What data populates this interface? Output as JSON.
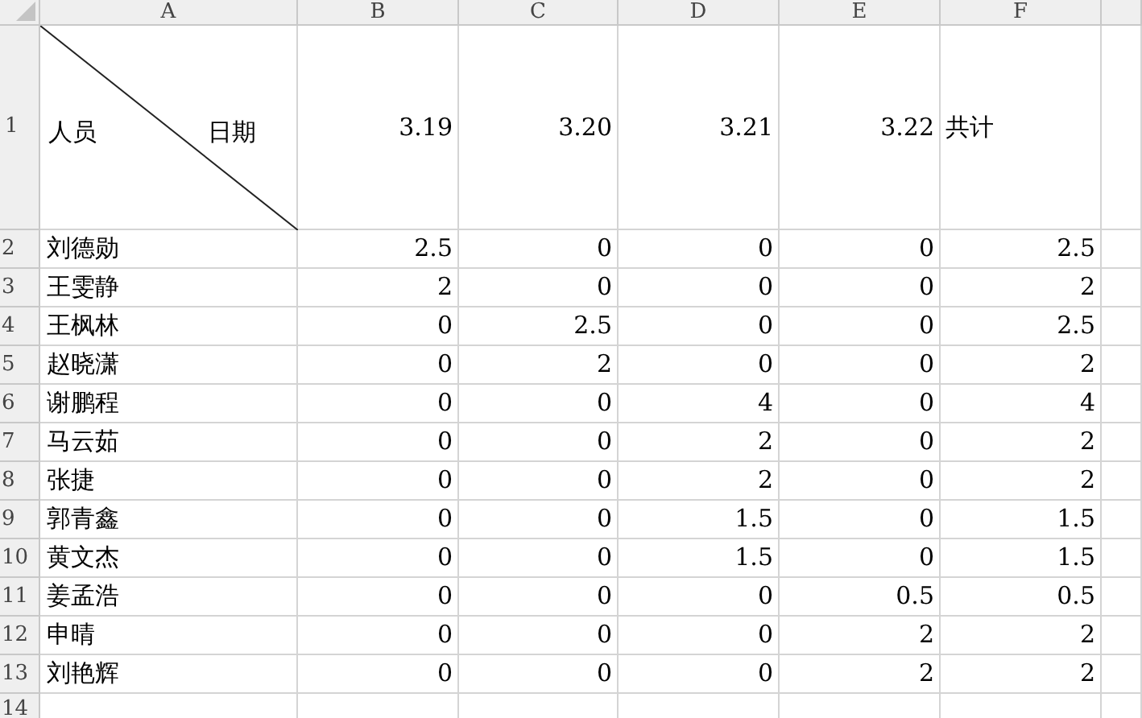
{
  "columns": [
    "A",
    "B",
    "C",
    "D",
    "E",
    "F"
  ],
  "row_numbers": [
    "1",
    "2",
    "3",
    "4",
    "5",
    "6",
    "7",
    "8",
    "9",
    "10",
    "11",
    "12",
    "13",
    "14"
  ],
  "header_row": {
    "person_label": "人员",
    "date_label": "日期",
    "dates": [
      "3.19",
      "3.20",
      "3.21",
      "3.22"
    ],
    "total_label": "共计"
  },
  "rows": [
    {
      "name": "刘德勋",
      "values": [
        "2.5",
        "0",
        "0",
        "0"
      ],
      "total": "2.5"
    },
    {
      "name": "王雯静",
      "values": [
        "2",
        "0",
        "0",
        "0"
      ],
      "total": "2"
    },
    {
      "name": "王枫林",
      "values": [
        "0",
        "2.5",
        "0",
        "0"
      ],
      "total": "2.5"
    },
    {
      "name": "赵晓潇",
      "values": [
        "0",
        "2",
        "0",
        "0"
      ],
      "total": "2"
    },
    {
      "name": "谢鹏程",
      "values": [
        "0",
        "0",
        "4",
        "0"
      ],
      "total": "4"
    },
    {
      "name": "马云茹",
      "values": [
        "0",
        "0",
        "2",
        "0"
      ],
      "total": "2"
    },
    {
      "name": "张捷",
      "values": [
        "0",
        "0",
        "2",
        "0"
      ],
      "total": "2"
    },
    {
      "name": "郭青鑫",
      "values": [
        "0",
        "0",
        "1.5",
        "0"
      ],
      "total": "1.5"
    },
    {
      "name": "黄文杰",
      "values": [
        "0",
        "0",
        "1.5",
        "0"
      ],
      "total": "1.5"
    },
    {
      "name": "姜孟浩",
      "values": [
        "0",
        "0",
        "0",
        "0.5"
      ],
      "total": "0.5"
    },
    {
      "name": "申晴",
      "values": [
        "0",
        "0",
        "0",
        "2"
      ],
      "total": "2"
    },
    {
      "name": "刘艳辉",
      "values": [
        "0",
        "0",
        "0",
        "2"
      ],
      "total": "2"
    }
  ]
}
